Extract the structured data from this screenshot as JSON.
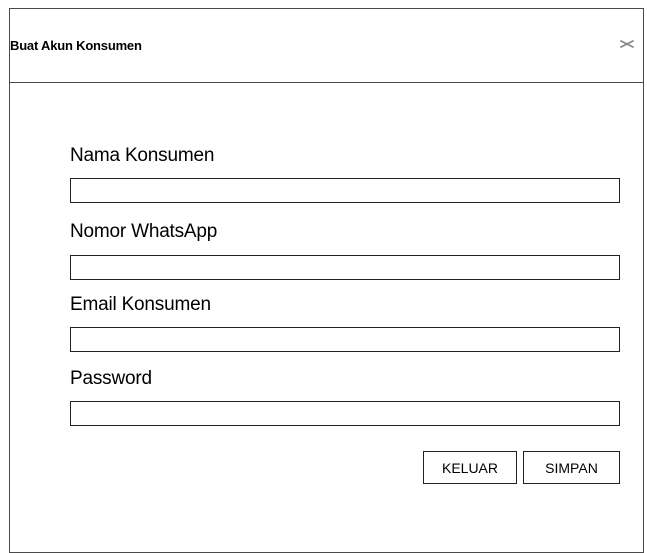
{
  "dialog": {
    "title": "Buat Akun Konsumen",
    "close_icon": "close-icon"
  },
  "form": {
    "fields": [
      {
        "label": "Nama Konsumen",
        "value": "",
        "placeholder": ""
      },
      {
        "label": "Nomor WhatsApp",
        "value": "",
        "placeholder": ""
      },
      {
        "label": "Email Konsumen",
        "value": "",
        "placeholder": ""
      },
      {
        "label": "Password",
        "value": "",
        "placeholder": ""
      }
    ]
  },
  "actions": {
    "cancel_label": "KELUAR",
    "save_label": "SIMPAN"
  }
}
